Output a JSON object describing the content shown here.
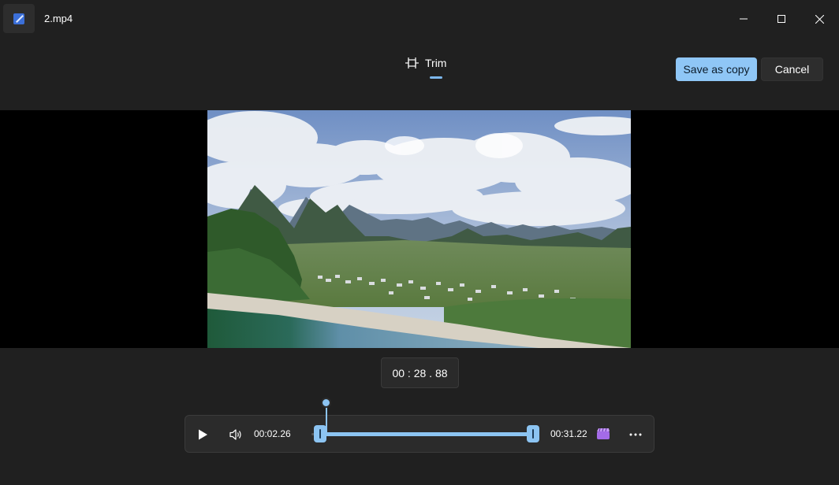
{
  "window": {
    "file_name": "2.mp4"
  },
  "toolbar": {
    "tab_label": "Trim",
    "save_label": "Save as copy",
    "cancel_label": "Cancel"
  },
  "playback": {
    "current_time": "00 : 28 . 88",
    "trim_start": "00:02.26",
    "trim_end": "00:31.22",
    "trim_start_fraction": 0.04,
    "trim_end_fraction": 0.96,
    "playhead_fraction": 0.07
  },
  "icons": {
    "app": "photos-edit-icon",
    "trim": "trim-icon",
    "play": "play-icon",
    "volume": "volume-icon",
    "clip": "clapperboard-icon",
    "more": "more-icon"
  },
  "colors": {
    "accent": "#8cc4f2",
    "save_button": "#8fc6f6",
    "background": "#202020",
    "clip_icon": "#a46be8"
  }
}
